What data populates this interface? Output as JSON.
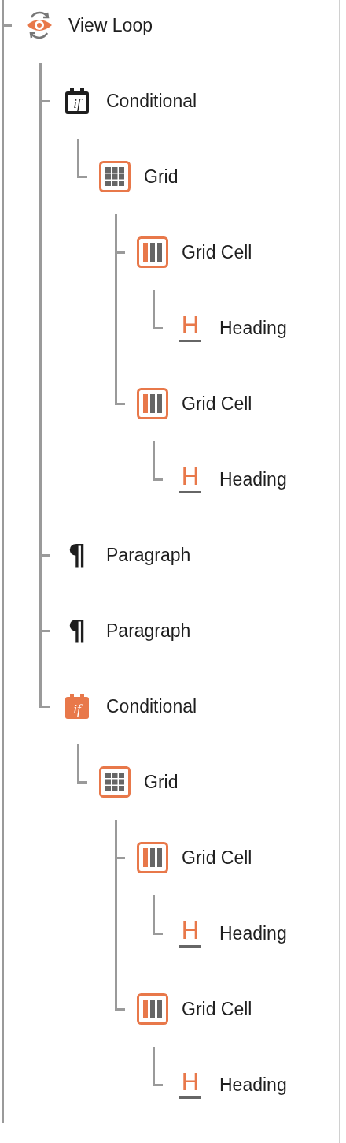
{
  "tree": [
    {
      "label": "View Loop",
      "kind": "view-loop",
      "children": [
        {
          "label": "Conditional",
          "kind": "conditional",
          "glyph": "if",
          "color": "#1e1e1e",
          "filled": false,
          "children": [
            {
              "label": "Grid",
              "kind": "grid",
              "children": [
                {
                  "label": "Grid Cell",
                  "kind": "grid-cell",
                  "children": [
                    {
                      "label": "Heading",
                      "kind": "heading",
                      "glyph": "H"
                    }
                  ]
                },
                {
                  "label": "Grid Cell",
                  "kind": "grid-cell",
                  "children": [
                    {
                      "label": "Heading",
                      "kind": "heading",
                      "glyph": "H"
                    }
                  ]
                }
              ]
            }
          ]
        },
        {
          "label": "Paragraph",
          "kind": "paragraph",
          "glyph": "¶"
        },
        {
          "label": "Paragraph",
          "kind": "paragraph",
          "glyph": "¶"
        },
        {
          "label": "Conditional",
          "kind": "conditional",
          "glyph": "if",
          "color": "#e8784a",
          "filled": true,
          "children": [
            {
              "label": "Grid",
              "kind": "grid",
              "children": [
                {
                  "label": "Grid Cell",
                  "kind": "grid-cell",
                  "children": [
                    {
                      "label": "Heading",
                      "kind": "heading",
                      "glyph": "H"
                    }
                  ]
                },
                {
                  "label": "Grid Cell",
                  "kind": "grid-cell",
                  "children": [
                    {
                      "label": "Heading",
                      "kind": "heading",
                      "glyph": "H"
                    }
                  ]
                }
              ]
            }
          ]
        }
      ]
    }
  ]
}
